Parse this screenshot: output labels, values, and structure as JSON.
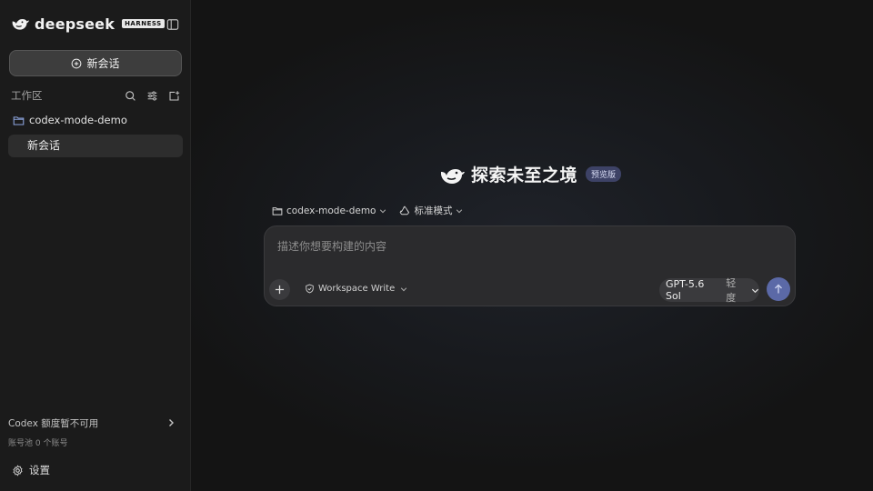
{
  "brand": {
    "name": "deepseek",
    "badge": "HARNESS"
  },
  "sidebar": {
    "new_chat_label": "新会话",
    "workspace_title": "工作区",
    "folder_name": "codex-mode-demo",
    "session_label": "新会话",
    "quota_title": "Codex 额度暂不可用",
    "quota_subtitle": "账号池 0 个账号",
    "settings_label": "设置"
  },
  "main": {
    "hero_title": "探索未至之境",
    "hero_badge": "预览版",
    "project_label": "codex-mode-demo",
    "mode_label": "标准模式",
    "composer_placeholder": "描述你想要构建的内容",
    "permission_label": "Workspace Write",
    "model_name": "GPT-5.6 Sol",
    "model_level": "轻度"
  },
  "colors": {
    "sidebar_bg": "#1b1b1b",
    "main_bg": "#141414",
    "composer_bg": "#2b2b2d",
    "send_button": "#5b69a7",
    "hero_badge_bg": "#3d4266"
  },
  "icons": {
    "logo": "whale-icon",
    "collapse": "sidebar-toggle-icon",
    "new_chat": "plus-circle-icon",
    "search": "search-icon",
    "filter": "sliders-icon",
    "new_folder": "folder-plus-icon",
    "folder": "folder-icon",
    "quota_chevron": "chevron-right-icon",
    "settings": "gear-icon",
    "mode": "recycle-icon",
    "permission": "shield-check-icon",
    "send": "arrow-up-icon"
  }
}
